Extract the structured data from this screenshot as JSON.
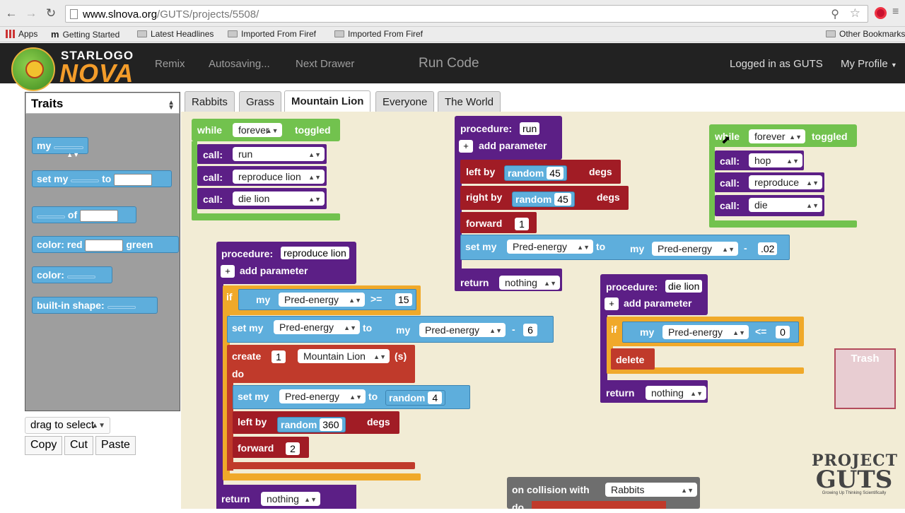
{
  "browser": {
    "url_domain": "www.slnova.org",
    "url_path": "/GUTS/projects/5508/",
    "bookmarks": [
      "Apps",
      "Getting Started",
      "Latest Headlines",
      "Imported From Firef",
      "Imported From Firef"
    ],
    "other_bookmarks": "Other Bookmarks"
  },
  "logo": {
    "line1": "STARLOGO",
    "line2": "NOVA"
  },
  "nav": {
    "remix": "Remix",
    "autosaving": "Autosaving...",
    "next_drawer": "Next Drawer",
    "run_code": "Run Code",
    "logged_in": "Logged in as GUTS",
    "my_profile": "My Profile"
  },
  "drawer": {
    "selected": "Traits",
    "blocks": {
      "my": "my",
      "set_my": "set my",
      "to": "to",
      "of": "of",
      "color_red": "color: red",
      "green": "green",
      "color": "color:",
      "builtin_shape": "built-in shape:"
    }
  },
  "toolbar": {
    "drag_select": "drag to select",
    "copy": "Copy",
    "cut": "Cut",
    "paste": "Paste"
  },
  "tabs": [
    "Rabbits",
    "Grass",
    "Mountain Lion",
    "Everyone",
    "The World"
  ],
  "active_tab": "Mountain Lion",
  "kw": {
    "while": "while",
    "forever": "forever",
    "toggled": "toggled",
    "call": "call:",
    "procedure": "procedure:",
    "add_parameter": "add parameter",
    "if": "if",
    "set_my": "set my",
    "to": "to",
    "my": "my",
    "create": "create",
    "s": "(s)",
    "do": "do",
    "left_by": "left by",
    "right_by": "right by",
    "random": "random",
    "degs": "degs",
    "forward": "forward",
    "return": "return",
    "nothing": "nothing",
    "delete": "delete",
    "on_collision": "on collision with",
    "pred_energy": "Pred-energy",
    "mountain_lion": "Mountain Lion",
    "rabbits": "Rabbits",
    "trash": "Trash",
    "gte": ">=",
    "lte": "<=",
    "minus": "-",
    "plus": "+"
  },
  "blocks": {
    "while1": {
      "calls": [
        "run",
        "reproduce lion",
        "die lion"
      ]
    },
    "while2": {
      "calls": [
        "hop",
        "reproduce",
        "die"
      ]
    },
    "proc_run": {
      "name": "run",
      "left": "45",
      "right": "45",
      "forward": "1",
      "dec": ".02"
    },
    "proc_repro": {
      "name": "reproduce lion",
      "threshold": "15",
      "cost": "6",
      "count": "1",
      "rand_energy": "4",
      "rand_left": "360",
      "forward": "2"
    },
    "proc_die": {
      "name": "die lion",
      "zero": "0"
    }
  },
  "branding": {
    "line1": "PROJECT",
    "line2": "GUTS",
    "tagline": "Growing Up Thinking Scientifically"
  }
}
